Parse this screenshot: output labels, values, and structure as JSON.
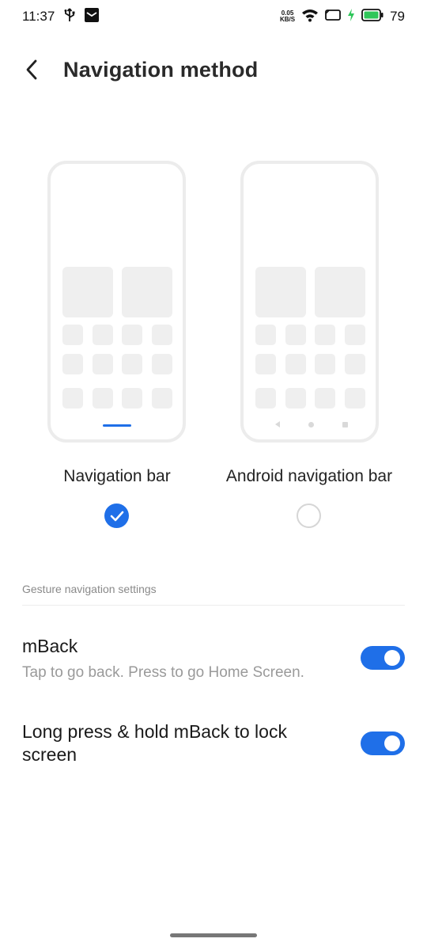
{
  "status_bar": {
    "time": "11:37",
    "speed_value": "0.05",
    "speed_unit": "KB/S",
    "battery_level": "79",
    "icons": [
      "usb-icon",
      "mail-icon",
      "wifi-icon",
      "screen-icon",
      "charging-icon",
      "battery-icon"
    ],
    "battery_color": "#2fc65a"
  },
  "header": {
    "title": "Navigation method"
  },
  "options": [
    {
      "label": "Navigation bar",
      "selected": true
    },
    {
      "label": "Android navigation bar",
      "selected": false
    }
  ],
  "gesture_section": {
    "header": "Gesture navigation settings",
    "items": [
      {
        "title": "mBack",
        "subtitle": "Tap to go back. Press to go Home Screen.",
        "enabled": true
      },
      {
        "title": "Long press & hold mBack to lock screen",
        "subtitle": "",
        "enabled": true
      }
    ]
  },
  "colors": {
    "accent": "#1f6fe8",
    "placeholder": "#efefef",
    "secondary_text": "#9a9a9a"
  }
}
